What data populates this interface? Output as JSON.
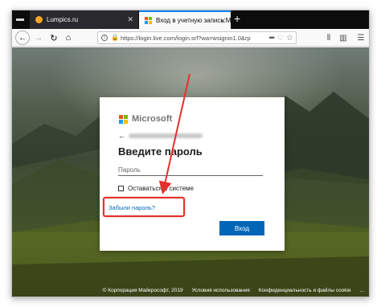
{
  "browser": {
    "tabs": [
      {
        "title": "Lumpics.ru",
        "favicon_color": "#f5a623"
      },
      {
        "title": "Вход в учетную запись Майкро",
        "active": true
      }
    ],
    "new_tab_label": "+",
    "close_glyph": "✕"
  },
  "url": {
    "text": "https://login.live.com/login.srf?wa=wsignin1.0&rp",
    "more": "•••"
  },
  "login": {
    "brand": "Microsoft",
    "brand_colors": [
      "#f25022",
      "#7fba00",
      "#00a4ef",
      "#ffb900"
    ],
    "heading": "Введите пароль",
    "password_placeholder": "Пароль",
    "keep_signed_in": "Оставаться в системе",
    "forgot_password": "Забыли пароль?",
    "sign_in_button": "Вход"
  },
  "footer": {
    "copyright": "© Корпорация Майкрософт, 2019",
    "terms": "Условия использования",
    "privacy": "Конфиденциальность и файлы cookie",
    "more": "..."
  },
  "annotation": {
    "highlight_color": "#e5312c"
  }
}
